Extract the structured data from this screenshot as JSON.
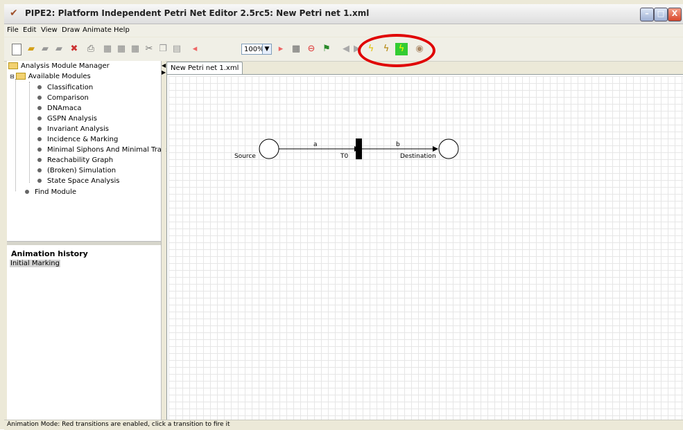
{
  "window": {
    "title": "PIPE2: Platform Independent Petri Net Editor 2.5rc5: New Petri net 1.xml",
    "minimize": "–",
    "maximize": "□",
    "close": "X"
  },
  "menu": [
    "File",
    "Edit",
    "View",
    "Draw",
    "Animate",
    "Help"
  ],
  "toolbar": {
    "zoom_value": "100%",
    "icons": [
      "new-icon",
      "open-icon",
      "save-icon",
      "save-as-icon",
      "close-file-icon",
      "print-icon",
      "export-png-icon",
      "export-ps-icon",
      "export-eps-icon",
      "cut-icon",
      "copy-icon",
      "paste-icon",
      "zoom-out-icon",
      "zoom-in-icon",
      "grid-icon",
      "delete-icon",
      "animate-toggle-icon",
      "step-back-icon",
      "step-forward-icon",
      "random-fire-icon",
      "animate-multiple-icon",
      "token-icon",
      "place-icon"
    ]
  },
  "modules": {
    "root": "Analysis Module Manager",
    "folder": "Available Modules",
    "items": [
      "Classification",
      "Comparison",
      "DNAmaca",
      "GSPN Analysis",
      "Invariant Analysis",
      "Incidence & Marking",
      "Minimal Siphons And Minimal Traps",
      "Reachability Graph",
      "(Broken) Simulation",
      "State Space Analysis"
    ],
    "find": "Find Module"
  },
  "history": {
    "title": "Animation history",
    "items": [
      "Initial Marking"
    ]
  },
  "tabs": [
    "New Petri net 1.xml"
  ],
  "net": {
    "place_source": "Source",
    "place_destination": "Destination",
    "transition": "T0",
    "arc_a": "a",
    "arc_b": "b"
  },
  "status": "Animation Mode: Red transitions are enabled, click a transition to fire it"
}
